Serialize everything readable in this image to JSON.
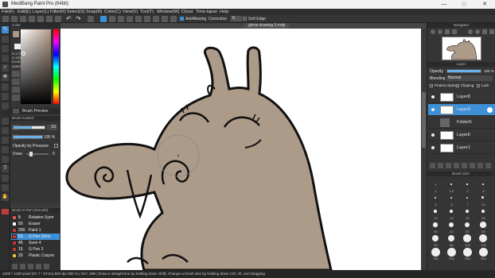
{
  "app": {
    "title": "MediBang Paint Pro (64bit)",
    "window_buttons": [
      "—",
      "□",
      "✕"
    ]
  },
  "menu": [
    "File(F)",
    "Edit(E)",
    "Layer(L)",
    "Filter(R)",
    "Select(S)",
    "Snap(N)",
    "Color(C)",
    "View(V)",
    "Tool(T)",
    "Window(W)",
    "Cloud",
    "Time-lapse",
    "Help"
  ],
  "commandbar": {
    "antialiasing_label": "AntiAliasing",
    "correction_label": "Correction",
    "correction_value": "0",
    "soft_edge_label": "Soft Edge"
  },
  "document_tab": "gloria drawing 3.mdp",
  "color_panel": {
    "title": "Color",
    "r": "R:171",
    "g": "G:153",
    "b": "B:136",
    "hex": "#AB9988",
    "brush_preview_label": "Brush Preview"
  },
  "brush_control": {
    "title": "Brush Control",
    "size_value": "53",
    "opacity_value": "100 %",
    "opacity_by_pressure_label": "Opacity by Pressure",
    "draw_label": "Draw",
    "draw_value": "0",
    "size_level": 0.6,
    "opacity_level": 1.0
  },
  "brush_list": {
    "title": "Brush G Pen (Smooth)",
    "items": [
      {
        "size": "8",
        "name": "Rotation Symr",
        "color": "#e05a5a",
        "selected": false
      },
      {
        "size": "50",
        "name": "Eraser",
        "color": "#ffffff",
        "selected": false
      },
      {
        "size": "200",
        "name": "Paint 1",
        "color": "#c03a3a",
        "selected": false
      },
      {
        "size": "53",
        "name": "G Pen (Smo",
        "color": "#c03a3a",
        "selected": true
      },
      {
        "size": "45",
        "name": "Sumi 4",
        "color": "#c03a3a",
        "selected": false
      },
      {
        "size": "15",
        "name": "G Pen 3",
        "color": "#c03a3a",
        "selected": false
      },
      {
        "size": "20",
        "name": "Plastic Crayon",
        "color": "#e0c040",
        "selected": false
      }
    ]
  },
  "navigator": {
    "title": "Navigator"
  },
  "layer_panel": {
    "title": "Layer",
    "opacity_label": "Opacity",
    "opacity_value": "100 %",
    "blending_label": "Blending",
    "blending_value": "Normal",
    "protect_alpha_label": "Protect Alpha",
    "clipping_label": "Clipping",
    "lock_label": "Lock",
    "layers": [
      {
        "name": "Layer8",
        "selected": false
      },
      {
        "name": "Layer9",
        "selected": true
      },
      {
        "name": "Folder5",
        "selected": false
      },
      {
        "name": "Layer6",
        "selected": false
      },
      {
        "name": "Layer1",
        "selected": false
      }
    ]
  },
  "brush_size_panel": {
    "title": "Brush Size",
    "labels": [
      "1",
      "1.5",
      "2",
      "3",
      "4",
      "5",
      "7",
      "10",
      "12",
      "15",
      "20",
      "25",
      "30",
      "40",
      "50",
      "60",
      "70",
      "80",
      "100",
      "120",
      "150",
      "200",
      "250",
      "300"
    ]
  },
  "status": "2200 * 1400 pixel  (97.7 * 57cm)  600 dpi  300 %  ( 817, 289 )  Draw a straight line by holding down Shift, Change a brush size by holding down Ctrl, Alt, and dragging",
  "colors": {
    "accent": "#3d8fd6",
    "current_color": "#ab9988",
    "hippo_fill": "#ad9b8a"
  }
}
